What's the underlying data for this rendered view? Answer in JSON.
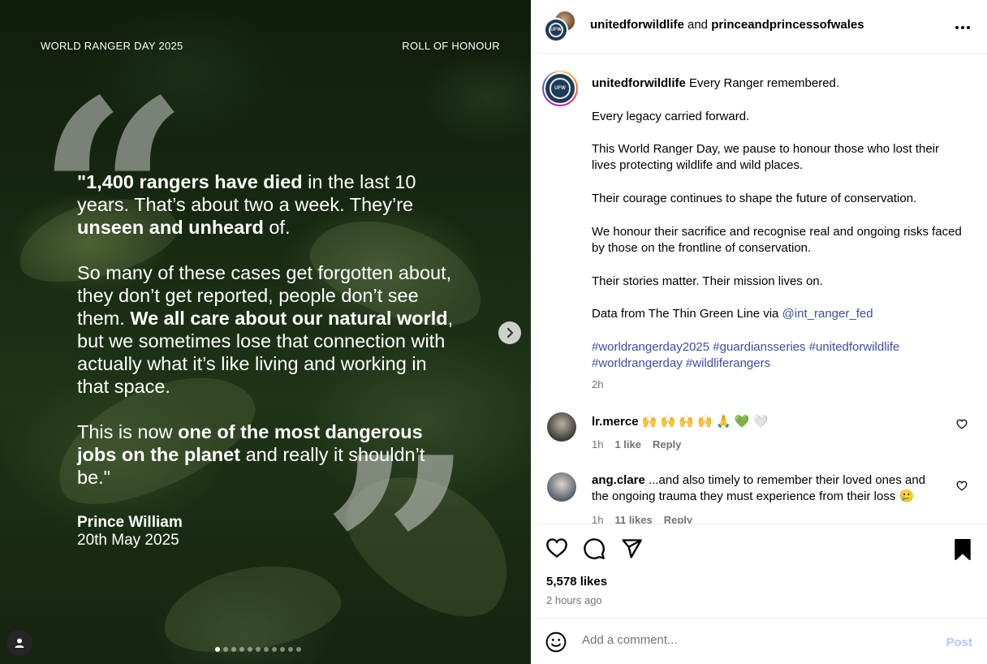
{
  "media": {
    "top_left": "WORLD RANGER DAY 2025",
    "top_right": "ROLL OF HONOUR",
    "quote": {
      "p1_a": "\"1,400 rangers have died",
      "p1_b": " in the last 10 years. That’s about two a week. They’re ",
      "p1_c": "unseen and unheard",
      "p1_d": " of.",
      "p2_a": "So many of these cases get forgotten about, they don’t get reported, people don’t see them. ",
      "p2_b": "We all care about our natural world",
      "p2_c": ", but we sometimes lose that connection with actually what it’s like living and working in that space.",
      "p3_a": "This is now ",
      "p3_b": "one of the most dangerous jobs on the planet",
      "p3_c": " and really it shouldn’t be.\""
    },
    "attribution_name": "Prince William",
    "attribution_date": "20th May 2025",
    "carousel_count": 11,
    "carousel_active": 0
  },
  "header": {
    "account1": "unitedforwildlife",
    "joiner": " and ",
    "account2": "princeandprincessofwales",
    "more": "•••"
  },
  "caption": {
    "username": "unitedforwildlife",
    "line1": " Every Ranger remembered.",
    "p2": "Every legacy carried forward.",
    "p3": "This World Ranger Day, we pause to honour those who lost their lives protecting wildlife and wild places.",
    "p4": "Their courage continues to shape the future of conservation.",
    "p5": "We honour their sacrifice and recognise real and ongoing risks faced by those on the frontline of conservation.",
    "p6": "Their stories matter. Their mission lives on.",
    "p7_text": "Data from The Thin Green Line via ",
    "p7_mention": "@int_ranger_fed",
    "hashtags_line1": "#worldrangerday2025 #guardiansseries #unitedforwildlife",
    "hashtags_line2": "#worldrangerday #wildliferangers",
    "time": "2h"
  },
  "comments": [
    {
      "username": "lr.merce",
      "text": " 🙌 🙌 🙌 🙌 🙏 💚 🤍",
      "time": "1h",
      "likes": "1 like",
      "reply": "Reply"
    },
    {
      "username": "ang.clare",
      "text": " ...and also timely to remember their loved ones and the ongoing trauma they must experience from their loss 🥲",
      "time": "1h",
      "likes": "11 likes",
      "reply": "Reply"
    }
  ],
  "actions": {
    "likes": "5,578 likes",
    "ago": "2 hours ago"
  },
  "add_comment": {
    "placeholder": "Add a comment...",
    "post": "Post"
  },
  "colors": {
    "link": "#3b4fa3",
    "muted": "#737373",
    "post_disabled": "#b3c8f5"
  }
}
